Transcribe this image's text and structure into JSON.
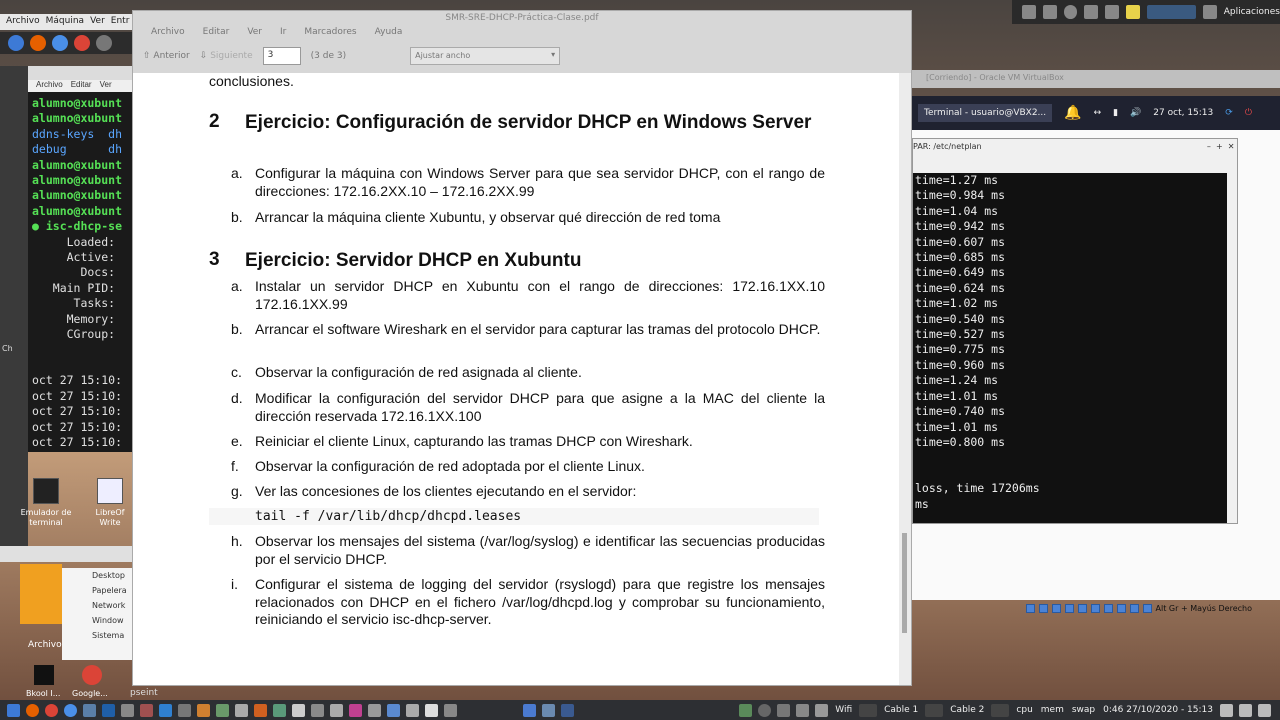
{
  "host_menu": [
    "Archivo",
    "Máquina",
    "Ver",
    "Entr"
  ],
  "left_terminal": {
    "menu": [
      "Archivo",
      "Editar",
      "Ver"
    ],
    "lines": [
      {
        "t": "alumno@xubunt",
        "c": "g"
      },
      {
        "t": "alumno@xubunt",
        "c": "g"
      },
      {
        "t": "ddns-keys  dh",
        "c": "b"
      },
      {
        "t": "debug      dh",
        "c": "b"
      },
      {
        "t": "alumno@xubunt",
        "c": "g"
      },
      {
        "t": "alumno@xubunt",
        "c": "g"
      },
      {
        "t": "alumno@xubunt",
        "c": "g"
      },
      {
        "t": "alumno@xubunt",
        "c": "g"
      },
      {
        "t": "● isc-dhcp-se",
        "c": "g"
      },
      {
        "t": "     Loaded: ",
        "c": ""
      },
      {
        "t": "     Active: ",
        "c": ""
      },
      {
        "t": "       Docs: ",
        "c": ""
      },
      {
        "t": "   Main PID: ",
        "c": ""
      },
      {
        "t": "      Tasks: ",
        "c": ""
      },
      {
        "t": "     Memory: ",
        "c": ""
      },
      {
        "t": "     CGroup: ",
        "c": ""
      },
      {
        "t": "",
        "c": ""
      },
      {
        "t": "",
        "c": ""
      },
      {
        "t": "oct 27 15:10:",
        "c": ""
      },
      {
        "t": "oct 27 15:10:",
        "c": ""
      },
      {
        "t": "oct 27 15:10:",
        "c": ""
      },
      {
        "t": "oct 27 15:10:",
        "c": ""
      },
      {
        "t": "oct 27 15:10:",
        "c": ""
      }
    ],
    "small_text": "Ch"
  },
  "desktop_icons": [
    {
      "label": "Emulador de terminal"
    },
    {
      "label": "LibreOf Write"
    }
  ],
  "file_manager": [
    "Desktop",
    "Papelera",
    "Network",
    "Window",
    "Sistema"
  ],
  "archivo_label": "Archivo",
  "bottom_icons": [
    "Bkool I...",
    "Google..."
  ],
  "viewer": {
    "title": "SMR-SRE-DHCP-Práctica-Clase.pdf",
    "menu": [
      "Archivo",
      "Editar",
      "Ver",
      "Ir",
      "Marcadores",
      "Ayuda"
    ],
    "prev": "Anterior",
    "next": "Siguiente",
    "page": "3",
    "page_of": "(3 de 3)",
    "zoom": "Ajustar ancho"
  },
  "doc": {
    "cont": "conclusiones.",
    "s2_num": "2",
    "s2_title": "Ejercicio: Configuración de servidor DHCP en Windows Server",
    "s2_a": "Configurar la máquina con Windows Server para que sea servidor DHCP, con el rango de direcciones: 172.16.2XX.10 – 172.16.2XX.99",
    "s2_b": "Arrancar la máquina cliente Xubuntu, y observar qué dirección de red toma",
    "s3_num": "3",
    "s3_title": "Ejercicio: Servidor DHCP en Xubuntu",
    "s3_a": "Instalar un servidor DHCP en Xubuntu con el rango de direcciones: 172.16.1XX.10 172.16.1XX.99",
    "s3_b": "Arrancar el software Wireshark en el servidor para capturar las tramas del protocolo DHCP.",
    "s3_c": "Observar la configuración de red asignada al cliente.",
    "s3_d": "Modificar la configuración del servidor DHCP para que asigne a la MAC del cliente la dirección reservada 172.16.1XX.100",
    "s3_e": "Reiniciar el cliente Linux, capturando las tramas DHCP con Wireshark.",
    "s3_f": "Observar la configuración de red adoptada por el cliente Linux.",
    "s3_g": "Ver las concesiones de los clientes ejecutando en el servidor:",
    "s3_code": "tail -f /var/lib/dhcp/dhcpd.leases",
    "s3_h": "Observar los mensajes del sistema (/var/log/syslog) e identificar las secuencias producidas por el servicio DHCP.",
    "s3_i": "Configurar el sistema de logging del servidor (rsyslogd) para que registre los mensajes relacionados con DHCP en el fichero /var/log/dhcpd.log y comprobar su funcionamiento, reiniciando el servicio isc-dhcp-server.",
    "letters": [
      "a.",
      "b.",
      "a.",
      "b.",
      "c.",
      "d.",
      "e.",
      "f.",
      "g.",
      "h.",
      "i."
    ]
  },
  "vbox": {
    "window_title": "[Corriendo] - Oracle VM VirtualBox",
    "tab": "Terminal - usuario@VBX2...",
    "date": "27 oct, 15:13",
    "term_title": "PAR: /etc/netplan",
    "ping_lines": [
      "time=1.27 ms",
      "time=0.984 ms",
      "time=1.04 ms",
      "time=0.942 ms",
      "time=0.607 ms",
      "time=0.685 ms",
      "time=0.649 ms",
      "time=0.624 ms",
      "time=1.02 ms",
      "time=0.540 ms",
      "time=0.527 ms",
      "time=0.775 ms",
      "time=0.960 ms",
      "time=1.24 ms",
      "time=1.01 ms",
      "time=0.740 ms",
      "time=1.01 ms",
      "time=0.800 ms",
      "",
      "",
      "loss, time 17206ms",
      "ms"
    ],
    "status_key": "Alt Gr + Mayús Derecho"
  },
  "top_tray": {
    "label": "Aplicaciones"
  },
  "taskbar": {
    "pseint": "pseint",
    "wifi": "Wifi",
    "cable1": "Cable 1",
    "cable2": "Cable 2",
    "cpu": "cpu",
    "mem": "mem",
    "swap": "swap",
    "clock": "0:46  27/10/2020 - 15:13"
  }
}
